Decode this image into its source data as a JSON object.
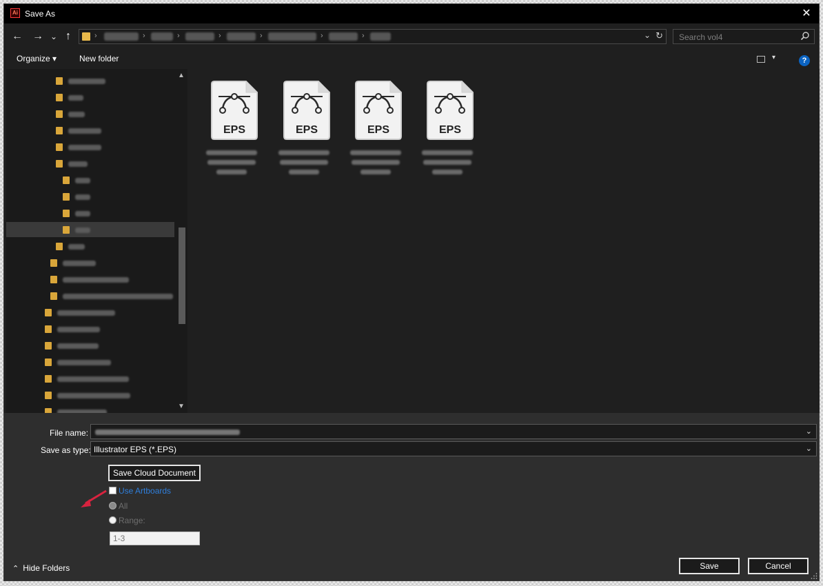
{
  "window": {
    "title": "Save As",
    "close_glyph": "✕",
    "app_icon_text": "Ai"
  },
  "navigation": {
    "back_glyph": "←",
    "forward_glyph": "→",
    "recent_glyph": "⌄",
    "up_glyph": "↑",
    "address_dropdown_glyph": "⌄",
    "refresh_glyph": "↻",
    "search_placeholder": "Search vol4"
  },
  "toolbar": {
    "organize_label": "Organize ▾",
    "new_folder_label": "New folder",
    "help_glyph": "?",
    "view_dropdown_glyph": "▾"
  },
  "tree": {
    "scroll_up_glyph": "▲",
    "scroll_down_glyph": "▼"
  },
  "files": [
    {
      "type_label": "EPS"
    },
    {
      "type_label": "EPS"
    },
    {
      "type_label": "EPS"
    },
    {
      "type_label": "EPS"
    }
  ],
  "form": {
    "file_name_label": "File name:",
    "save_as_type_label": "Save as type:",
    "save_as_type_value": "Illustrator EPS (*.EPS)",
    "dropdown_glyph": "⌄"
  },
  "options": {
    "save_cloud_document": "Save Cloud Document",
    "use_artboards": "Use Artboards",
    "all_label": "All",
    "range_label": "Range:",
    "range_value": "1-3"
  },
  "footer": {
    "hide_folders": "Hide Folders",
    "hide_folders_glyph": "⌃",
    "save": "Save",
    "cancel": "Cancel"
  },
  "colors": {
    "accent_link": "#2f7fdc",
    "folder": "#d9a63a",
    "arrow_annotation": "#d9233f"
  }
}
